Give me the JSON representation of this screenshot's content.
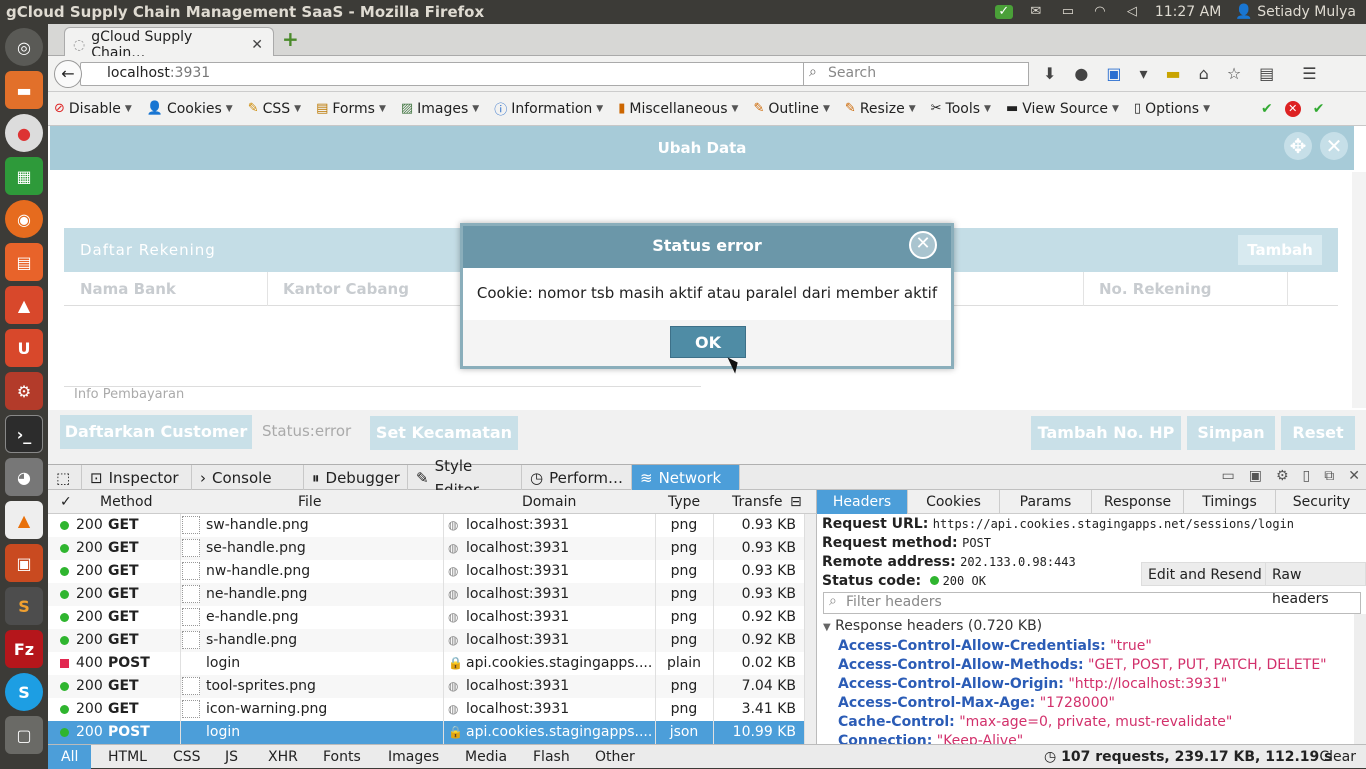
{
  "os": {
    "window_title": "gCloud Supply Chain Management SaaS - Mozilla Firefox",
    "time": "11:27 AM",
    "user": "Setiady Mulya"
  },
  "browser": {
    "tab_title": "gCloud Supply Chain…",
    "url_host": "localhost",
    "url_port": ":3931",
    "search_placeholder": "Search"
  },
  "webdev": [
    "Disable",
    "Cookies",
    "CSS",
    "Forms",
    "Images",
    "Information",
    "Miscellaneous",
    "Outline",
    "Resize",
    "Tools",
    "View Source",
    "Options"
  ],
  "page": {
    "dialog_title": "Ubah Data",
    "rekening_title": "Daftar Rekening",
    "tambah": "Tambah",
    "col_bank": "Nama Bank",
    "col_cabang": "Kantor Cabang",
    "col_norek": "No. Rekening",
    "info_pembayaran": "Info Pembayaran",
    "btn_daftarkan": "Daftarkan Customer",
    "status": "Status:error",
    "btn_kecamatan": "Set Kecamatan",
    "btn_tambah_hp": "Tambah No. HP",
    "btn_simpan": "Simpan",
    "btn_reset": "Reset"
  },
  "alert": {
    "title": "Status error",
    "message": "Cookie: nomor tsb masih aktif atau paralel dari member aktif",
    "ok": "OK"
  },
  "devtools": {
    "tabs": [
      "Inspector",
      "Console",
      "Debugger",
      "Style Editor",
      "Perform…",
      "Network"
    ],
    "columns": {
      "check": "✓",
      "method": "Method",
      "file": "File",
      "domain": "Domain",
      "type": "Type",
      "transfer": "Transfe"
    },
    "requests": [
      {
        "code": "200",
        "method": "GET",
        "file": "sw-handle.png",
        "domain": "localhost:3931",
        "type": "png",
        "size": "0.93 KB"
      },
      {
        "code": "200",
        "method": "GET",
        "file": "se-handle.png",
        "domain": "localhost:3931",
        "type": "png",
        "size": "0.93 KB"
      },
      {
        "code": "200",
        "method": "GET",
        "file": "nw-handle.png",
        "domain": "localhost:3931",
        "type": "png",
        "size": "0.93 KB"
      },
      {
        "code": "200",
        "method": "GET",
        "file": "ne-handle.png",
        "domain": "localhost:3931",
        "type": "png",
        "size": "0.93 KB"
      },
      {
        "code": "200",
        "method": "GET",
        "file": "e-handle.png",
        "domain": "localhost:3931",
        "type": "png",
        "size": "0.92 KB"
      },
      {
        "code": "200",
        "method": "GET",
        "file": "s-handle.png",
        "domain": "localhost:3931",
        "type": "png",
        "size": "0.92 KB"
      },
      {
        "code": "400",
        "method": "POST",
        "file": "login",
        "domain": "api.cookies.stagingapps....",
        "type": "plain",
        "size": "0.02 KB"
      },
      {
        "code": "200",
        "method": "GET",
        "file": "tool-sprites.png",
        "domain": "localhost:3931",
        "type": "png",
        "size": "7.04 KB"
      },
      {
        "code": "200",
        "method": "GET",
        "file": "icon-warning.png",
        "domain": "localhost:3931",
        "type": "png",
        "size": "3.41 KB"
      },
      {
        "code": "200",
        "method": "POST",
        "file": "login",
        "domain": "api.cookies.stagingapps....",
        "type": "json",
        "size": "10.99 KB"
      }
    ],
    "filters": [
      "All",
      "HTML",
      "CSS",
      "JS",
      "XHR",
      "Fonts",
      "Images",
      "Media",
      "Flash",
      "Other"
    ],
    "summary": "107 requests, 239.17 KB, 112.19 s",
    "clear": "Clear",
    "detail_tabs": [
      "Headers",
      "Cookies",
      "Params",
      "Response",
      "Timings",
      "Security"
    ],
    "request_url_label": "Request URL:",
    "request_url": "https://api.cookies.stagingapps.net/sessions/login",
    "request_method_label": "Request method:",
    "request_method": "POST",
    "remote_label": "Remote address:",
    "remote": "202.133.0.98:443",
    "status_label": "Status code:",
    "status_code": "200 OK",
    "edit_resend": "Edit and Resend",
    "raw_headers": "Raw headers",
    "filter_headers": "Filter headers",
    "response_headers": "Response headers (0.720 KB)",
    "headers": [
      {
        "k": "Access-Control-Allow-Credentials:",
        "v": "\"true\""
      },
      {
        "k": "Access-Control-Allow-Methods:",
        "v": "\"GET, POST, PUT, PATCH, DELETE\""
      },
      {
        "k": "Access-Control-Allow-Origin:",
        "v": "\"http://localhost:3931\""
      },
      {
        "k": "Access-Control-Max-Age:",
        "v": "\"1728000\""
      },
      {
        "k": "Cache-Control:",
        "v": "\"max-age=0, private, must-revalidate\""
      },
      {
        "k": "Connection:",
        "v": "\"Keep-Alive\""
      }
    ]
  }
}
